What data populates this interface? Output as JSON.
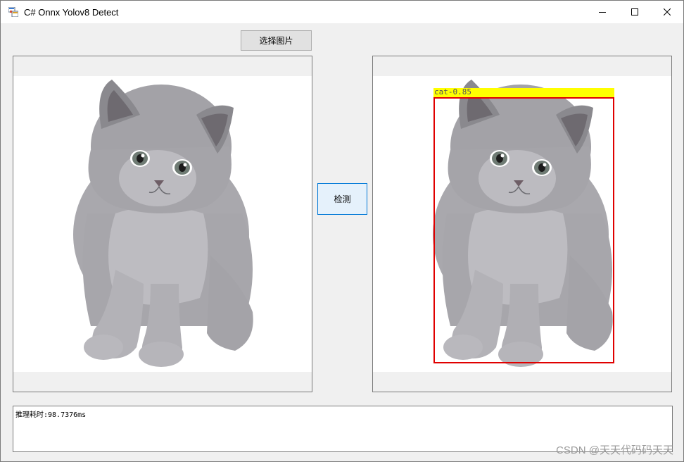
{
  "window": {
    "title": "C# Onnx Yolov8 Detect",
    "icon": "winforms-app-icon"
  },
  "controls": {
    "minimize": "minimize-icon",
    "maximize": "maximize-icon",
    "close": "close-icon"
  },
  "toolbar": {
    "select_image_label": "选择图片",
    "detect_label": "检测"
  },
  "detection": {
    "label": "cat-0.85",
    "confidence": 0.85,
    "box_color": "#e00000",
    "label_bg_color": "#ffff00"
  },
  "output": {
    "text": "推理耗时:98.7376ms"
  },
  "watermark": "CSDN @天天代码码天天"
}
